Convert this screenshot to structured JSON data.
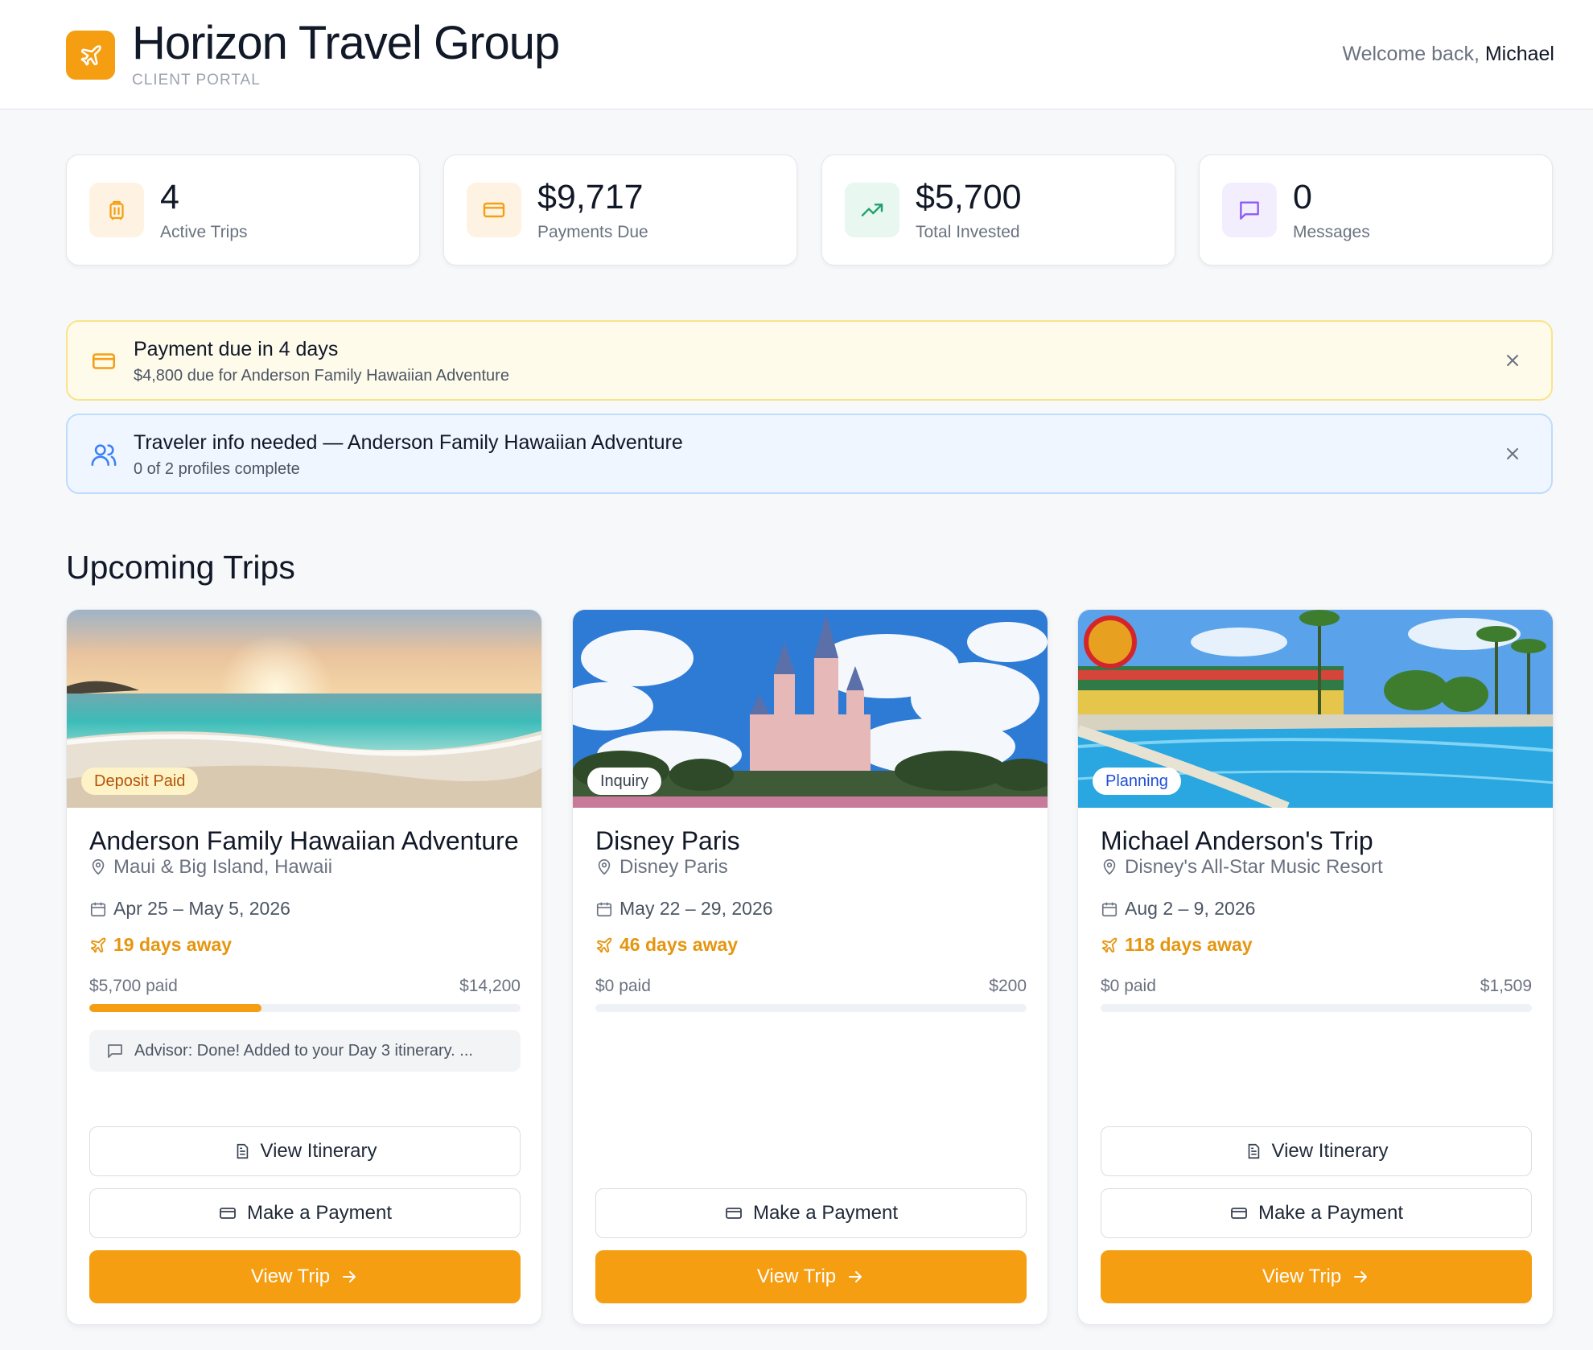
{
  "header": {
    "title": "Horizon Travel Group",
    "subtitle": "CLIENT PORTAL",
    "welcome_prefix": "Welcome back,",
    "user_name": "Michael"
  },
  "stats": [
    {
      "value": "4",
      "label": "Active Trips",
      "icon": "luggage-icon",
      "color": "#f59e12"
    },
    {
      "value": "$9,717",
      "label": "Payments Due",
      "icon": "credit-card-icon",
      "color": "#f59e12"
    },
    {
      "value": "$5,700",
      "label": "Total Invested",
      "icon": "trending-up-icon",
      "color": "#22a06b"
    },
    {
      "value": "0",
      "label": "Messages",
      "icon": "message-icon",
      "color": "#8b5cf6"
    }
  ],
  "alerts": [
    {
      "title": "Payment due in 4 days",
      "subtitle": "$4,800 due for Anderson Family Hawaiian Adventure",
      "icon": "credit-card-icon"
    },
    {
      "title": "Traveler info needed — Anderson Family Hawaiian Adventure",
      "subtitle": "0 of 2 profiles complete",
      "icon": "users-icon"
    }
  ],
  "section_title": "Upcoming Trips",
  "trips": [
    {
      "status": "Deposit Paid",
      "title": "Anderson Family Hawaiian Adventure",
      "location": "Maui & Big Island, Hawaii",
      "dates": "Apr 25 – May 5, 2026",
      "days_away": "19 days away",
      "paid": "$5,700 paid",
      "total": "$14,200",
      "progress_fraction": 0.4,
      "advisor_message": "Advisor: Done! Added to your Day 3 itinerary. ...",
      "view_itinerary": "View Itinerary",
      "make_payment": "Make a Payment",
      "view_trip": "View Trip"
    },
    {
      "status": "Inquiry",
      "title": "Disney Paris",
      "location": "Disney Paris",
      "dates": "May 22 – 29, 2026",
      "days_away": "46 days away",
      "paid": "$0 paid",
      "total": "$200",
      "progress_fraction": 0,
      "make_payment": "Make a Payment",
      "view_trip": "View Trip"
    },
    {
      "status": "Planning",
      "title": "Michael Anderson's Trip",
      "location": "Disney's All-Star Music Resort",
      "dates": "Aug 2 – 9, 2026",
      "days_away": "118 days away",
      "paid": "$0 paid",
      "total": "$1,509",
      "progress_fraction": 0,
      "view_itinerary": "View Itinerary",
      "make_payment": "Make a Payment",
      "view_trip": "View Trip"
    }
  ]
}
